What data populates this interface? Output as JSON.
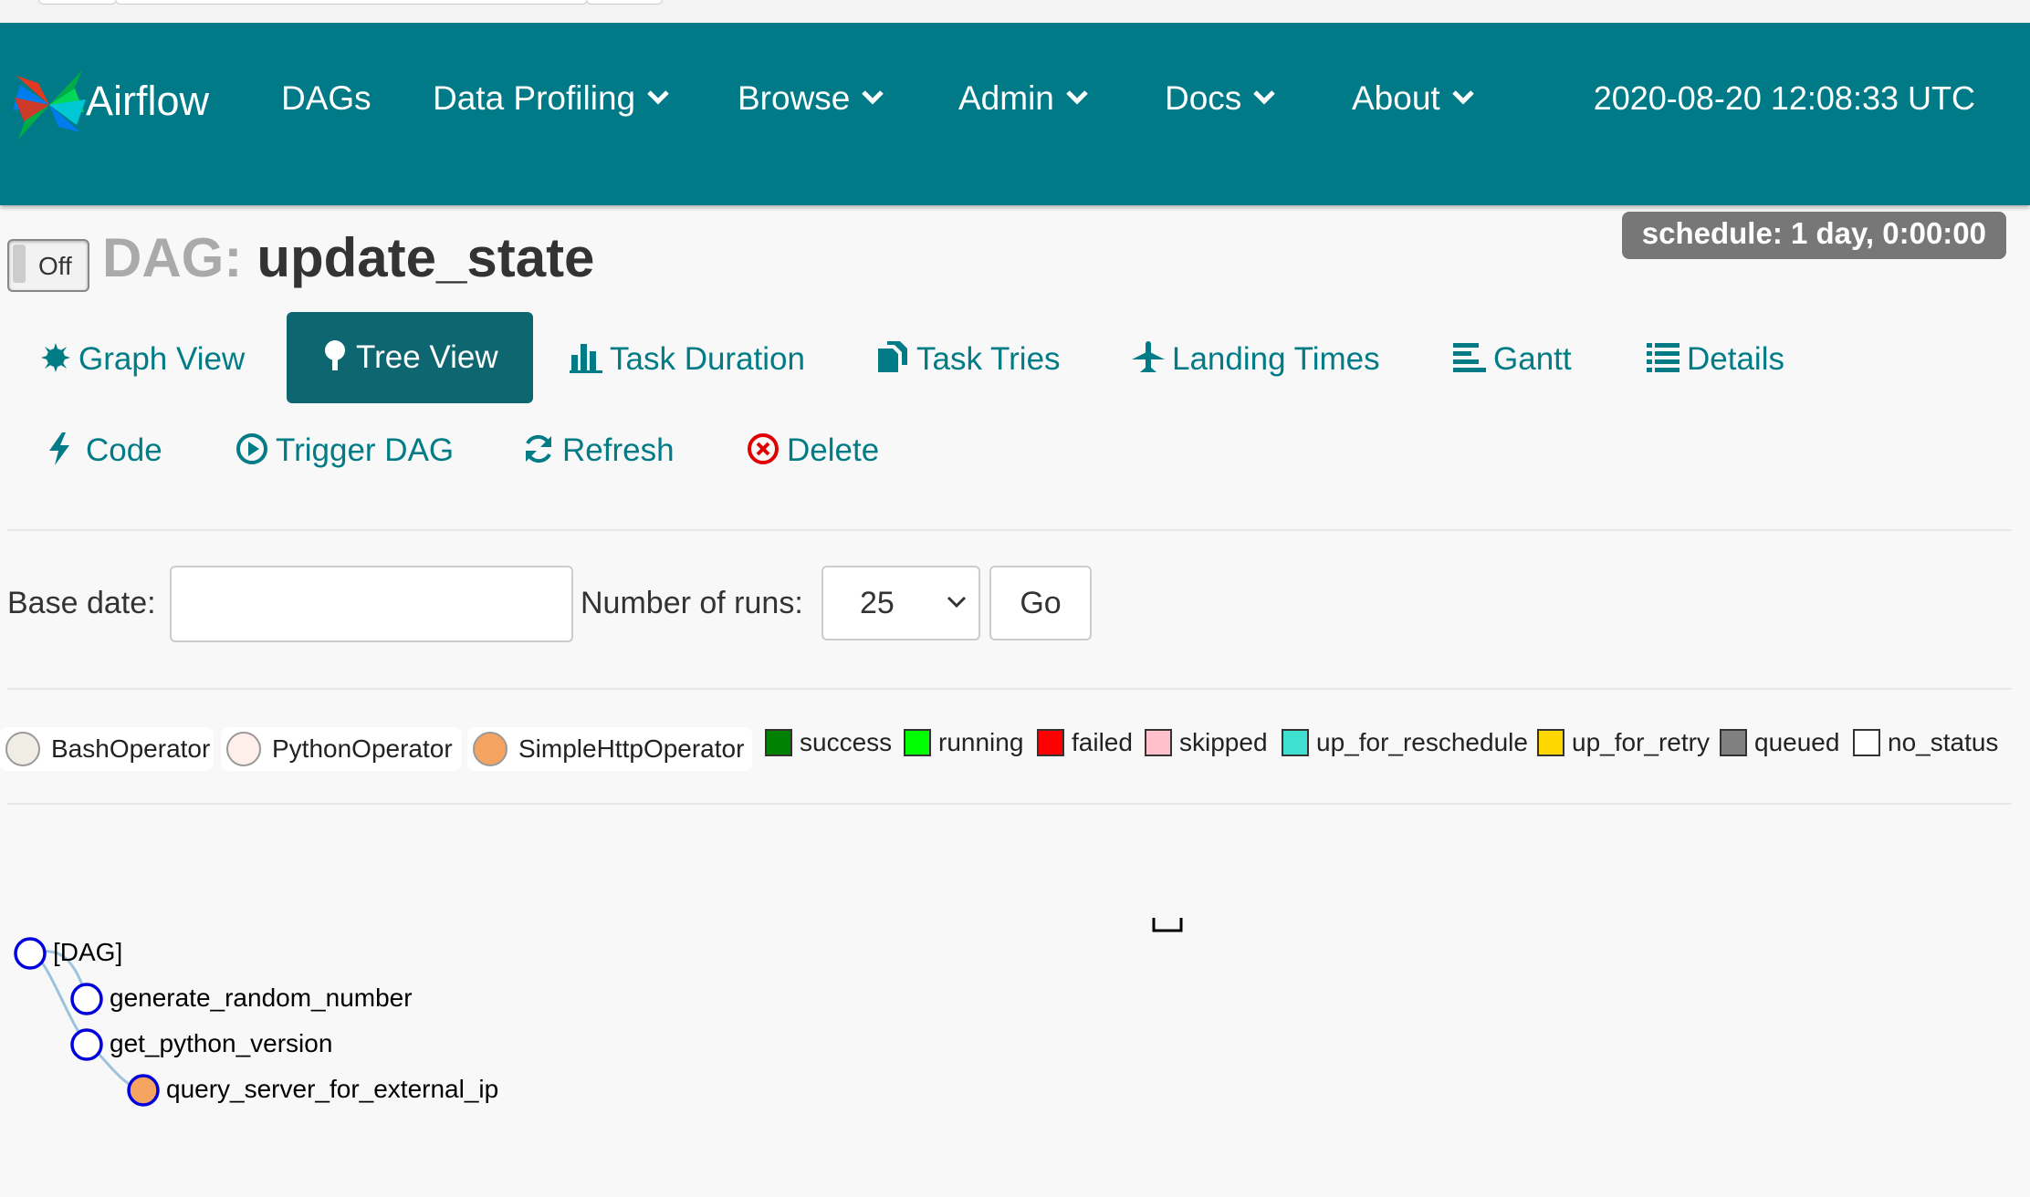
{
  "navbar": {
    "brand": "Airflow",
    "items": [
      {
        "label": "DAGs",
        "dropdown": false
      },
      {
        "label": "Data Profiling",
        "dropdown": true
      },
      {
        "label": "Browse",
        "dropdown": true
      },
      {
        "label": "Admin",
        "dropdown": true
      },
      {
        "label": "Docs",
        "dropdown": true
      },
      {
        "label": "About",
        "dropdown": true
      }
    ],
    "time": "2020-08-20 12:08:33 UTC",
    "bg_color": "#007a87"
  },
  "dag": {
    "toggle_label": "Off",
    "title_prefix": "DAG:",
    "name": "update_state",
    "schedule": "schedule: 1 day, 0:00:00"
  },
  "views": {
    "row1": [
      {
        "label": "Graph View",
        "icon": "asterisk-icon",
        "active": false
      },
      {
        "label": "Tree View",
        "icon": "tree-icon",
        "active": true
      },
      {
        "label": "Task Duration",
        "icon": "bar-chart-icon",
        "active": false
      },
      {
        "label": "Task Tries",
        "icon": "duplicate-icon",
        "active": false
      },
      {
        "label": "Landing Times",
        "icon": "plane-icon",
        "active": false
      },
      {
        "label": "Gantt",
        "icon": "align-left-icon",
        "active": false
      },
      {
        "label": "Details",
        "icon": "list-icon",
        "active": false
      }
    ],
    "row2": [
      {
        "label": "Code",
        "icon": "flash-icon"
      },
      {
        "label": "Trigger DAG",
        "icon": "play-circle-icon"
      },
      {
        "label": "Refresh",
        "icon": "refresh-icon"
      },
      {
        "label": "Delete",
        "icon": "remove-circle-icon",
        "icon_color": "#e00000"
      }
    ]
  },
  "form": {
    "base_date_label": "Base date:",
    "base_date_value": "",
    "runs_label": "Number of runs:",
    "runs_value": "25",
    "go_label": "Go"
  },
  "legend": {
    "operators": [
      {
        "name": "BashOperator",
        "color": "#f0ede4"
      },
      {
        "name": "PythonOperator",
        "color": "#ffefeb"
      },
      {
        "name": "SimpleHttpOperator",
        "color": "#f4a460"
      }
    ],
    "states": [
      {
        "name": "success",
        "color": "#008000"
      },
      {
        "name": "running",
        "color": "#00ff00"
      },
      {
        "name": "failed",
        "color": "#ff0000"
      },
      {
        "name": "skipped",
        "color": "#ffc0cb"
      },
      {
        "name": "up_for_reschedule",
        "color": "#40e0d0"
      },
      {
        "name": "up_for_retry",
        "color": "#ffd700"
      },
      {
        "name": "queued",
        "color": "#808080"
      },
      {
        "name": "no_status",
        "color": "#ffffff"
      }
    ]
  },
  "tree": {
    "nodes": [
      {
        "label": "[DAG]",
        "fill": "#ffffff"
      },
      {
        "label": "generate_random_number",
        "fill": "#ffffff"
      },
      {
        "label": "get_python_version",
        "fill": "#ffffff"
      },
      {
        "label": "query_server_for_external_ip",
        "fill": "#f4a460"
      }
    ]
  }
}
